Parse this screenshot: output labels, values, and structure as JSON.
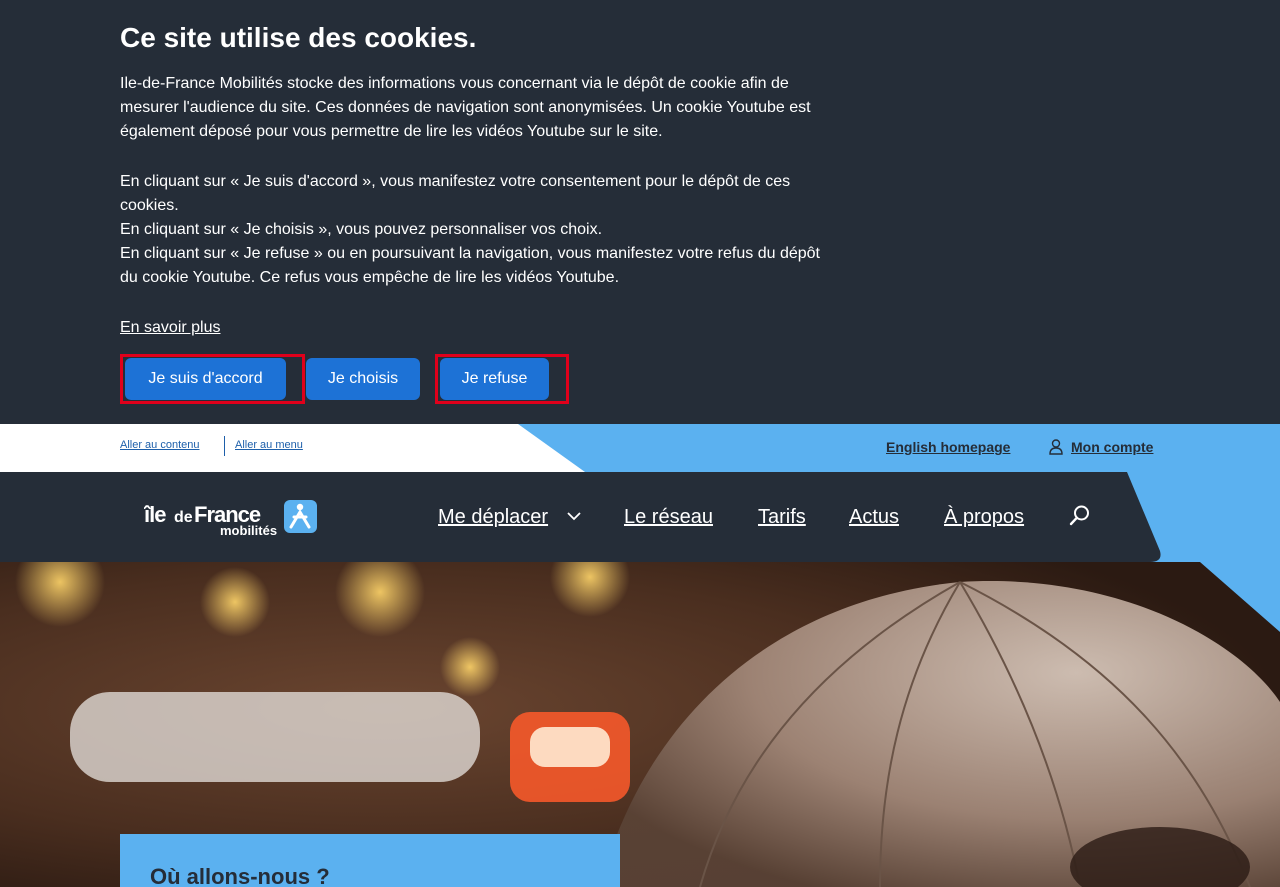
{
  "cookie": {
    "title": "Ce site utilise des cookies.",
    "paragraph1": "Ile-de-France Mobilités stocke des informations vous concernant via le dépôt de cookie afin de mesurer l'audience du site. Ces données de navigation sont anonymisées. Un cookie Youtube est également déposé pour vous permettre de lire les vidéos Youtube sur le site.",
    "paragraph2_line1": "En cliquant sur « Je suis d'accord », vous manifestez votre consentement pour le dépôt de ces cookies.",
    "paragraph2_line2": "En cliquant sur « Je choisis », vous pouvez personnaliser vos choix.",
    "paragraph2_line3": "En cliquant sur « Je refuse » ou en poursuivant la navigation, vous manifestez votre refus du dépôt du cookie Youtube. Ce refus vous empêche de lire les vidéos Youtube.",
    "learn_more": "En savoir plus",
    "accept_label": "Je suis d'accord",
    "choose_label": "Je choisis",
    "refuse_label": "Je refuse"
  },
  "utility": {
    "skip_content": "Aller au contenu",
    "skip_menu": "Aller au menu",
    "english": "English homepage",
    "account": "Mon compte"
  },
  "nav": {
    "logo_text_1": "îledeFrance",
    "logo_text_2": "mobilités",
    "items": [
      "Me déplacer",
      "Le réseau",
      "Tarifs",
      "Actus",
      "À propos"
    ]
  },
  "hero": {
    "card_title": "Où allons-nous ?"
  },
  "colors": {
    "dark": "#252d38",
    "button_blue": "#1d72d6",
    "light_blue": "#5bb1f0",
    "highlight_red": "#e0001b"
  },
  "icons": [
    "user-icon",
    "chevron-down-icon",
    "search-icon",
    "logo-figure-icon"
  ]
}
